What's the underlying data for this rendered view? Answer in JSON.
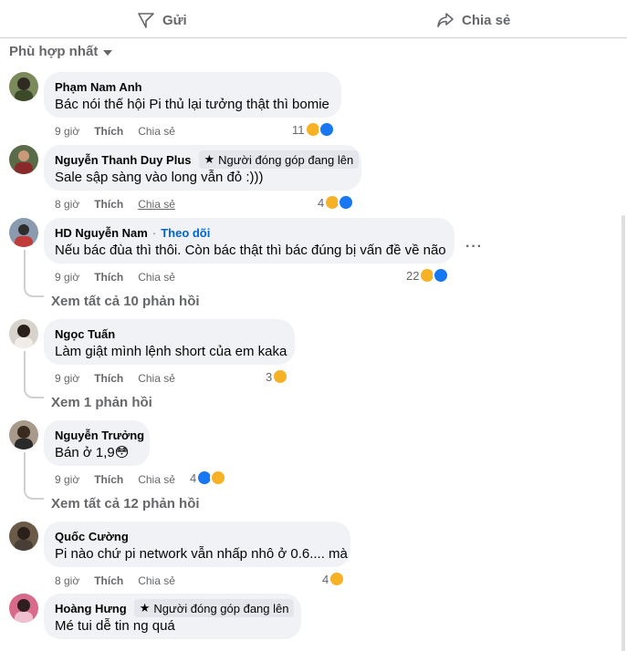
{
  "actions": {
    "send_label": "Gửi",
    "share_label": "Chia sẻ"
  },
  "sort": {
    "label": "Phù hợp nhất"
  },
  "comments": [
    {
      "author": "Phạm Nam Anh",
      "text": "Bác nói thế hội Pi thủ lại tưởng thật thì bomie",
      "time": "9 giờ",
      "like": "Thích",
      "share": "Chia sẻ",
      "reaction_count": "11",
      "reactions": [
        "haha-icon",
        "like-icon"
      ]
    },
    {
      "author": "Nguyễn Thanh Duy Plus",
      "badge": "Người đóng góp đang lên",
      "text": "Sale sập sàng vào long vẫn đỏ :)))",
      "time": "8 giờ",
      "like": "Thích",
      "share": "Chia sẻ",
      "reaction_count": "4",
      "reactions": [
        "haha-icon",
        "like-icon"
      ]
    },
    {
      "author": "HD Nguyễn Nam",
      "follow": "Theo dõi",
      "text": "Nếu bác đùa thì thôi. Còn bác thật thì bác đúng bị vấn đề về não",
      "time": "9 giờ",
      "like": "Thích",
      "share": "Chia sẻ",
      "reaction_count": "22",
      "reactions": [
        "haha-icon",
        "like-icon"
      ],
      "replies_label": "Xem tất cả 10 phản hồi"
    },
    {
      "author": "Ngọc Tuấn",
      "text": "Làm giật mình lệnh short của em kaka",
      "time": "9 giờ",
      "like": "Thích",
      "share": "Chia sẻ",
      "reaction_count": "3",
      "reactions": [
        "haha-icon"
      ],
      "replies_label": "Xem 1 phản hồi"
    },
    {
      "author": "Nguyễn Trưởng",
      "text": "Bán ở 1,9",
      "emoji": "😳",
      "time": "9 giờ",
      "like": "Thích",
      "share": "Chia sẻ",
      "reaction_count": "4",
      "reactions": [
        "like-icon",
        "haha-icon"
      ],
      "replies_label": "Xem tất cả 12 phản hồi"
    },
    {
      "author": "Quốc Cường",
      "text": "Pi nào chứ pi network vẫn nhấp nhô ở 0.6.... mà",
      "time": "8 giờ",
      "like": "Thích",
      "share": "Chia sẻ",
      "reaction_count": "4",
      "reactions": [
        "haha-icon"
      ]
    },
    {
      "author": "Hoàng Hưng",
      "badge": "Người đóng góp đang lên",
      "text": "Mé tui dễ tin ng quá"
    }
  ],
  "colors": {
    "like": "#1877f2",
    "haha": "#f7b125",
    "link": "#0064d1",
    "muted": "#65676b",
    "bubble": "#f0f2f5"
  }
}
